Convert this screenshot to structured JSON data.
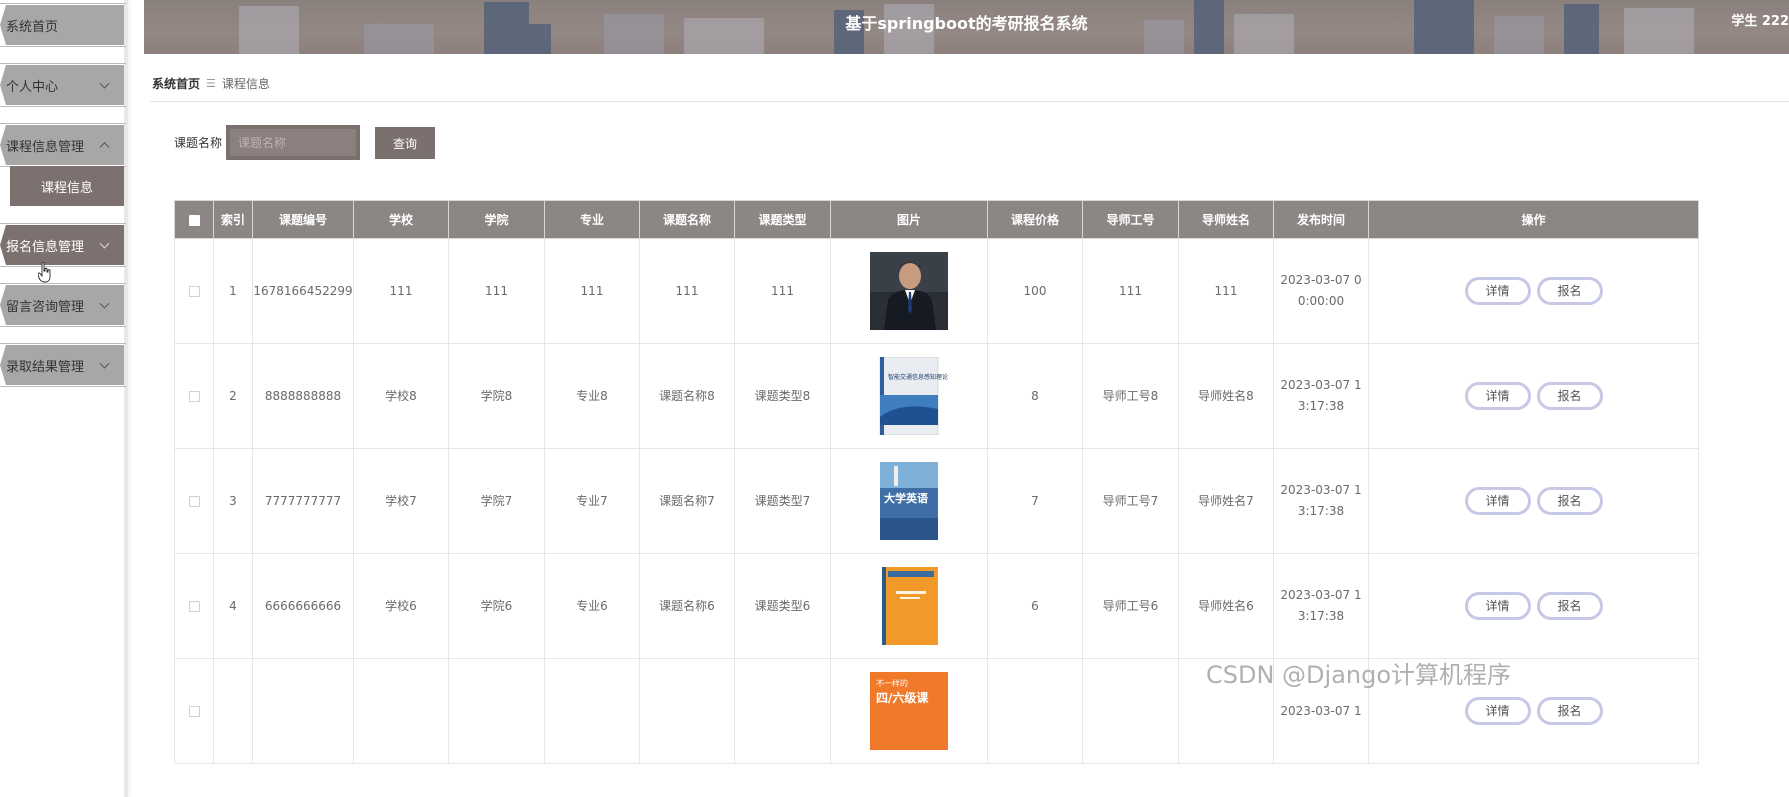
{
  "header": {
    "title": "基于springboot的考研报名系统",
    "user": "学生 222"
  },
  "sidebar": {
    "items": [
      {
        "label": "系统首页"
      },
      {
        "label": "个人中心"
      },
      {
        "label": "课程信息管理"
      },
      {
        "label": "报名信息管理"
      },
      {
        "label": "留言咨询管理"
      },
      {
        "label": "录取结果管理"
      }
    ],
    "sub_item": "课程信息"
  },
  "breadcrumb": {
    "home": "系统首页",
    "separator": "☰",
    "current": "课程信息"
  },
  "search": {
    "label": "课题名称",
    "placeholder": "课题名称",
    "value": "",
    "button": "查询"
  },
  "table": {
    "columns": [
      "",
      "索引",
      "课题编号",
      "学校",
      "学院",
      "专业",
      "课题名称",
      "课题类型",
      "图片",
      "课程价格",
      "导师工号",
      "导师姓名",
      "发布时间",
      "操作"
    ],
    "rows": [
      {
        "index": "1",
        "code": "1678166452299",
        "school": "111",
        "college": "111",
        "major": "111",
        "name": "111",
        "type": "111",
        "image": "portrait-photo",
        "price": "100",
        "tutor_id": "111",
        "tutor_name": "111",
        "time_line1": "2023-03-07 0",
        "time_line2": "0:00:00"
      },
      {
        "index": "2",
        "code": "8888888888",
        "school": "学校8",
        "college": "学院8",
        "major": "专业8",
        "name": "课题名称8",
        "type": "课题类型8",
        "image": "book-cover-tech",
        "price": "8",
        "tutor_id": "导师工号8",
        "tutor_name": "导师姓名8",
        "time_line1": "2023-03-07 1",
        "time_line2": "3:17:38"
      },
      {
        "index": "3",
        "code": "7777777777",
        "school": "学校7",
        "college": "学院7",
        "major": "专业7",
        "name": "课题名称7",
        "type": "课题类型7",
        "image": "book-cover-english",
        "price": "7",
        "tutor_id": "导师工号7",
        "tutor_name": "导师姓名7",
        "time_line1": "2023-03-07 1",
        "time_line2": "3:17:38"
      },
      {
        "index": "4",
        "code": "6666666666",
        "school": "学校6",
        "college": "学院6",
        "major": "专业6",
        "name": "课题名称6",
        "type": "课题类型6",
        "image": "book-cover-orange",
        "price": "6",
        "tutor_id": "导师工号6",
        "tutor_name": "导师姓名6",
        "time_line1": "2023-03-07 1",
        "time_line2": "3:17:38"
      },
      {
        "index": "",
        "code": "",
        "school": "",
        "college": "",
        "major": "",
        "name": "",
        "type": "",
        "image": "book-cover-cet",
        "price": "",
        "tutor_id": "",
        "tutor_name": "",
        "time_line1": "2023-03-07 1",
        "time_line2": ""
      }
    ],
    "actions": {
      "detail": "详情",
      "apply": "报名"
    },
    "cover_texts": {
      "tech_title": "智能交通信息感知理论与技术",
      "english_title": "大学英语",
      "cet_top": "不一样的",
      "cet_main": "四/六级课"
    }
  },
  "watermark": "CSDN @Django计算机程序",
  "colors": {
    "primary": "#7d7170",
    "header_bg": "#8a807d",
    "table_header": "#8c8685",
    "action_border": "#c6c8e6"
  }
}
